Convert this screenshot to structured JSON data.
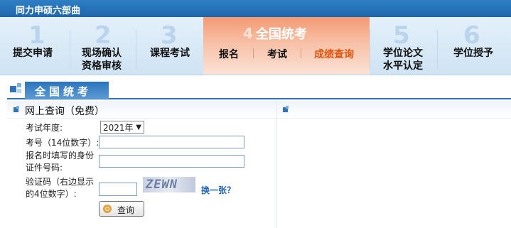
{
  "header": {
    "title": "同力申硕六部曲"
  },
  "steps": [
    {
      "num": "1",
      "label": "提交申请"
    },
    {
      "num": "2",
      "label": "现场确认\n资格审核"
    },
    {
      "num": "3",
      "label": "课程考试"
    },
    {
      "num": "4",
      "label": "全国统考"
    },
    {
      "num": "5",
      "label": "学位论文\n水平认定"
    },
    {
      "num": "6",
      "label": "学位授予"
    }
  ],
  "substeps": {
    "signup": "报名",
    "exam": "考试",
    "score": "成绩查询"
  },
  "section": {
    "title": "全国统考"
  },
  "panel": {
    "title": "网上查询（免费）",
    "year_label": "考试年度:",
    "year_value": "2021年",
    "exam_no_label": "考号（14位数字）:",
    "id_label_1": "报名时填写的身份",
    "id_label_2": "证件号码:",
    "captcha_label_1": "验证码（右边显示",
    "captcha_label_2": "的4位数字）:",
    "captcha_text": "ZEWN",
    "refresh_label": "换一张？",
    "query_button": "查询"
  },
  "colors": {
    "brand_blue": "#2f73b8",
    "active_step": "#f39a74",
    "current_sub": "#e0550e"
  }
}
